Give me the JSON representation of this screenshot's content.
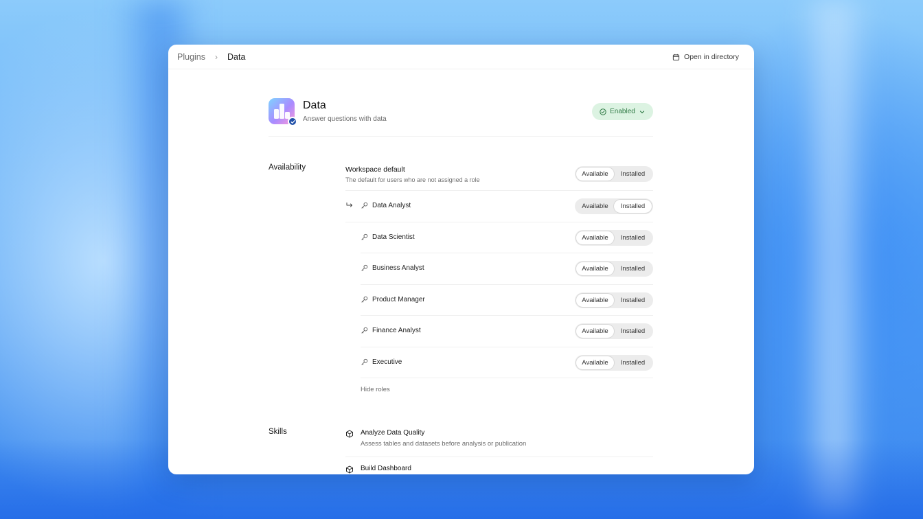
{
  "breadcrumb": {
    "root": "Plugins",
    "separator": "›",
    "current": "Data"
  },
  "toolbar": {
    "open_in_directory": "Open in directory"
  },
  "plugin": {
    "title": "Data",
    "subtitle": "Answer questions with data",
    "status": "Enabled",
    "status_color": "#2f7a45"
  },
  "availability": {
    "section_label": "Availability",
    "workspace_default": {
      "title": "Workspace default",
      "description": "The default for users who are not assigned a role",
      "selected": "Available"
    },
    "toggle_options": {
      "available": "Available",
      "installed": "Installed"
    },
    "roles": [
      {
        "name": "Data Analyst",
        "selected": "Installed"
      },
      {
        "name": "Data Scientist",
        "selected": "Available"
      },
      {
        "name": "Business Analyst",
        "selected": "Available"
      },
      {
        "name": "Product Manager",
        "selected": "Available"
      },
      {
        "name": "Finance Analyst",
        "selected": "Available"
      },
      {
        "name": "Executive",
        "selected": "Available"
      }
    ],
    "hide_roles": "Hide roles"
  },
  "skills": {
    "section_label": "Skills",
    "items": [
      {
        "title": "Analyze Data Quality",
        "description": "Assess tables and datasets before analysis or publication"
      },
      {
        "title": "Build Dashboard",
        "description": ""
      }
    ]
  }
}
